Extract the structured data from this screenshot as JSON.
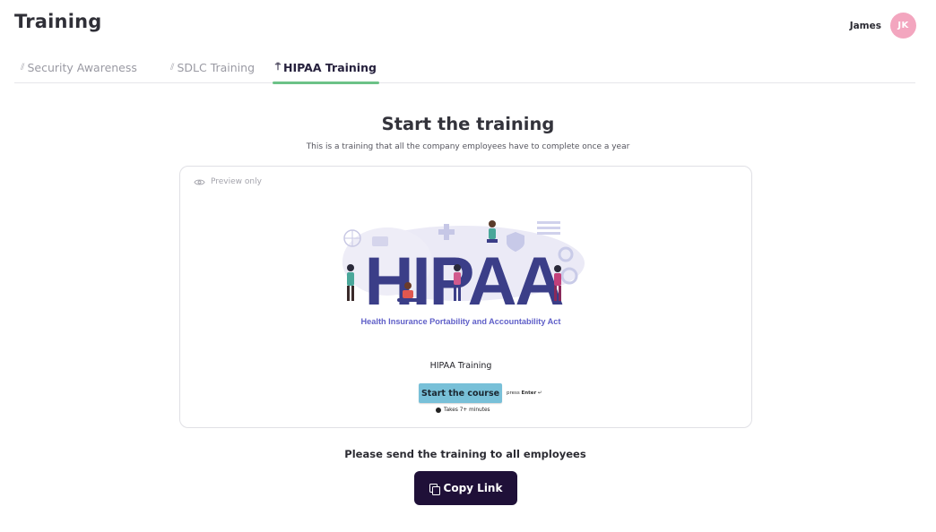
{
  "page": {
    "title": "Training"
  },
  "user": {
    "name": "James",
    "initials": "JK",
    "avatar_color": "#f3a6bf"
  },
  "tabs": [
    {
      "label": "Security Awareness",
      "icon": "chart-icon",
      "active": false
    },
    {
      "label": "SDLC Training",
      "icon": "chart-icon",
      "active": false
    },
    {
      "label": "HIPAA Training",
      "icon": "pin-icon",
      "active": true
    }
  ],
  "main": {
    "title": "Start the training",
    "subtitle": "This is a training that all the company employees have to complete once a year"
  },
  "preview": {
    "label": "Preview only",
    "banner": {
      "word": "HIPAA",
      "caption": "Health Insurance Portability and Accountability Act"
    },
    "course_title": "HIPAA Training",
    "start_button": "Start the course",
    "press_prefix": "press",
    "press_key": "Enter",
    "press_symbol": "↵",
    "duration": "Takes 7+ minutes"
  },
  "share": {
    "text": "Please send the training to all employees",
    "copy_button": "Copy Link"
  },
  "colors": {
    "accent_tab": "#6cc287",
    "copy_button": "#1f1038",
    "start_button": "#78c0d8",
    "hipaa_letters": "#3b3e88"
  }
}
